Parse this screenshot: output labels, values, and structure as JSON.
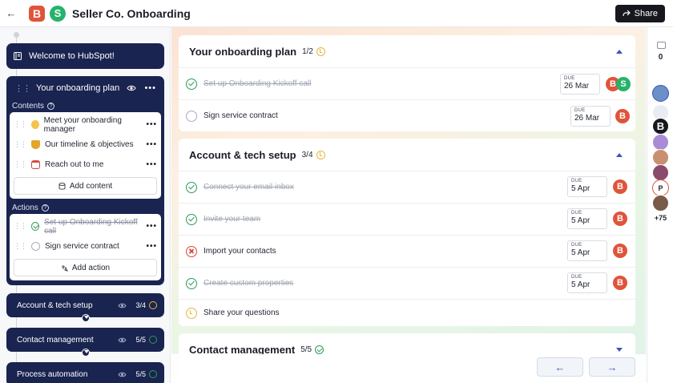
{
  "header": {
    "back_icon": "←",
    "brand_b": "B",
    "brand_s": "S",
    "title": "Seller Co. Onboarding",
    "share_label": "Share"
  },
  "sidebar": {
    "welcome_label": "Welcome to HubSpot!",
    "plan": {
      "title": "Your onboarding plan",
      "contents_label": "Contents",
      "contents": [
        {
          "label": "Meet your onboarding manager"
        },
        {
          "label": "Our timeline & objectives"
        },
        {
          "label": "Reach out to me"
        }
      ],
      "add_content_label": "Add content",
      "actions_label": "Actions",
      "actions": [
        {
          "label": "Set up Onboarding Kickoff call",
          "done": true
        },
        {
          "label": "Sign service contract",
          "done": false
        }
      ],
      "add_action_label": "Add action"
    },
    "sections": [
      {
        "label": "Account & tech setup",
        "count": "3/4",
        "status": "pending"
      },
      {
        "label": "Contact management",
        "count": "5/5",
        "status": "complete"
      },
      {
        "label": "Process automation",
        "count": "5/5",
        "status": "complete"
      }
    ]
  },
  "main": {
    "panels": [
      {
        "title": "Your onboarding plan",
        "count": "1/2",
        "tasks": [
          {
            "label": "Set up Onboarding Kickoff call",
            "status": "done",
            "due_label": "DUE",
            "due_date": "26 Mar"
          },
          {
            "label": "Sign service contract",
            "status": "todo",
            "due_label": "DUE",
            "due_date": "26 Mar"
          }
        ]
      },
      {
        "title": "Account & tech setup",
        "count": "3/4",
        "tasks": [
          {
            "label": "Connect your email inbox",
            "status": "done",
            "due_label": "DUE",
            "due_date": "5 Apr"
          },
          {
            "label": "Invite your team",
            "status": "done",
            "due_label": "DUE",
            "due_date": "5 Apr"
          },
          {
            "label": "Import your contacts",
            "status": "error",
            "due_label": "DUE",
            "due_date": "5 Apr"
          },
          {
            "label": "Create custom properties",
            "status": "done",
            "due_label": "DUE",
            "due_date": "5 Apr"
          },
          {
            "label": "Share your questions",
            "status": "pending"
          }
        ]
      },
      {
        "title": "Contact management",
        "count": "5/5"
      }
    ],
    "prev_icon": "←",
    "next_icon": "→"
  },
  "right_rail": {
    "comment_count": "0",
    "avatar_initial": "P",
    "avatar_b": "B",
    "more_count": "+75"
  },
  "colors": {
    "navy": "#1a2450",
    "brand_red": "#e0543a",
    "brand_green": "#25b36b",
    "success": "#2e9b58",
    "warning": "#e7b53a",
    "error": "#d94b3b"
  }
}
